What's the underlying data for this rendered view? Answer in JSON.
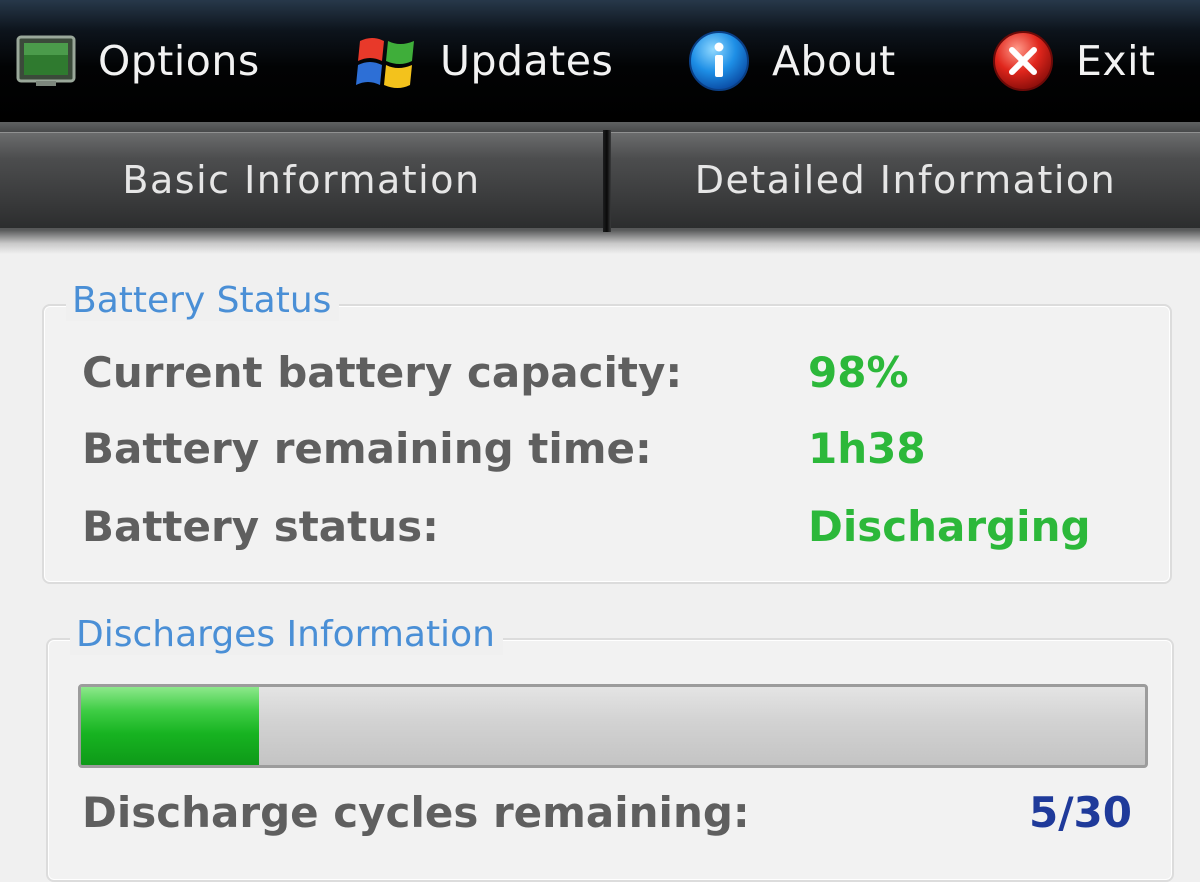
{
  "menu": {
    "options_label": "Options",
    "updates_label": "Updates",
    "about_label": "About",
    "exit_label": "Exit",
    "options_icon": "monitor-icon",
    "updates_icon": "windows-update-icon",
    "about_icon": "info-icon",
    "exit_icon": "close-icon"
  },
  "tabs": {
    "basic_label": "Basic Information",
    "detailed_label": "Detailed Information"
  },
  "battery_status": {
    "title": "Battery Status",
    "rows": [
      {
        "label": "Current battery capacity:",
        "value": "98%"
      },
      {
        "label": "Battery remaining time:",
        "value": "1h38"
      },
      {
        "label": "Battery status:",
        "value": "Discharging"
      }
    ]
  },
  "discharges": {
    "title": "Discharges Information",
    "progress_fraction": 0.167,
    "cycles_label": "Discharge cycles remaining:",
    "cycles_value": "5/30"
  },
  "colors": {
    "group_title": "#4a8fd6",
    "value_green": "#2cb83a",
    "cycles_blue": "#1f3a9a",
    "label_gray": "#5f5f5f"
  }
}
